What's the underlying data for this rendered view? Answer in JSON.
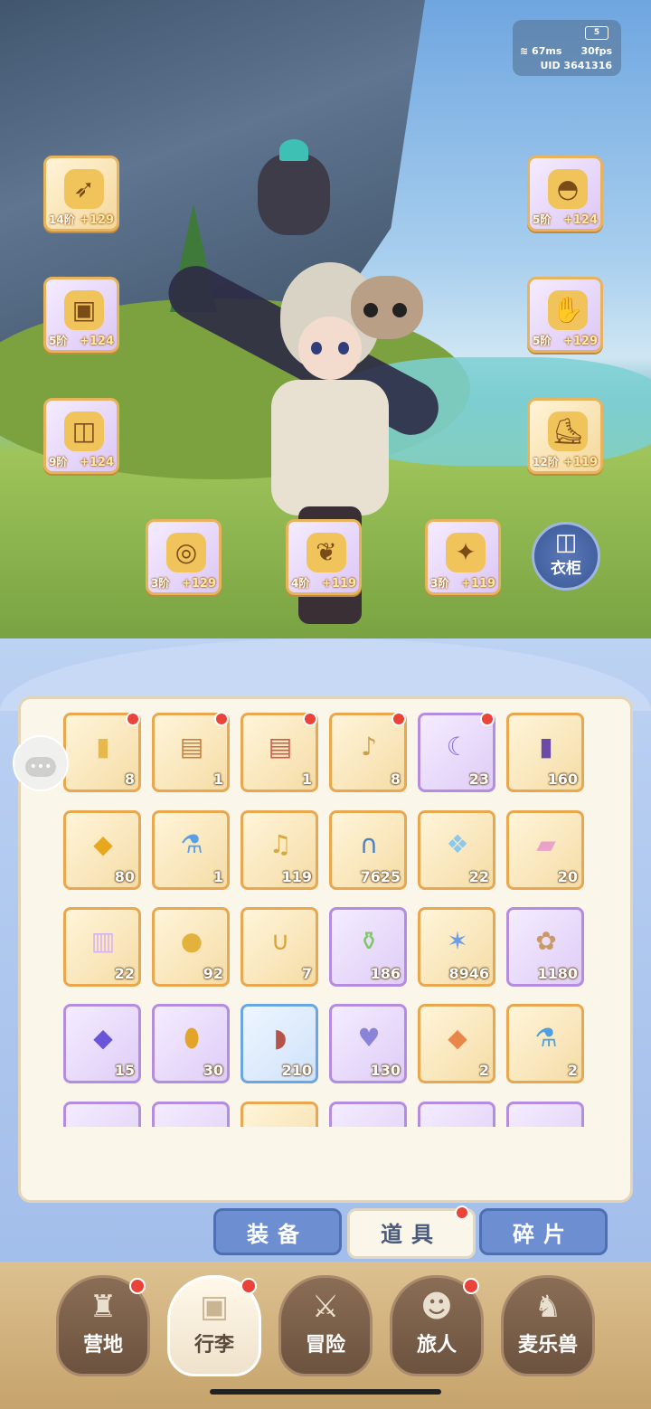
{
  "status": {
    "battery": "5",
    "ping": "67ms",
    "fps": "30fps",
    "uid": "UID 3641316"
  },
  "equipment": [
    {
      "slot": "bow",
      "tier": "14阶",
      "plus": "+129",
      "icon": "bow-icon",
      "glyph": "➶"
    },
    {
      "slot": "armor",
      "tier": "5阶",
      "plus": "+124",
      "icon": "armor-icon",
      "glyph": "▣"
    },
    {
      "slot": "pants",
      "tier": "9阶",
      "plus": "+124",
      "icon": "pants-icon",
      "glyph": "◫"
    },
    {
      "slot": "helmet",
      "tier": "5阶",
      "plus": "+124",
      "icon": "helmet-icon",
      "glyph": "◓"
    },
    {
      "slot": "gloves",
      "tier": "5阶",
      "plus": "+129",
      "icon": "gloves-icon",
      "glyph": "✋"
    },
    {
      "slot": "boots",
      "tier": "12阶",
      "plus": "+119",
      "icon": "boots-icon",
      "glyph": "⛸"
    },
    {
      "slot": "ring",
      "tier": "3阶",
      "plus": "+129",
      "icon": "ring-icon",
      "glyph": "◎"
    },
    {
      "slot": "necklace",
      "tier": "4阶",
      "plus": "+119",
      "icon": "necklace-icon",
      "glyph": "❦"
    },
    {
      "slot": "charm",
      "tier": "3阶",
      "plus": "+119",
      "icon": "charm-icon",
      "glyph": "✦"
    }
  ],
  "wardrobe": {
    "label": "衣柜",
    "icon": "wardrobe-icon"
  },
  "inventory": [
    {
      "count": "8",
      "icon": "card-icon",
      "glyph": "▮",
      "color": "#e9b84a",
      "rarity": "gold",
      "badge": true
    },
    {
      "count": "1",
      "icon": "chest-icon",
      "glyph": "▤",
      "color": "#c9803d",
      "rarity": "gold",
      "badge": true
    },
    {
      "count": "1",
      "icon": "red-chest-icon",
      "glyph": "▤",
      "color": "#d2584a",
      "rarity": "gold",
      "badge": true
    },
    {
      "count": "8",
      "icon": "bell-bag-icon",
      "glyph": "♪",
      "color": "#caa04a",
      "rarity": "gold",
      "badge": true
    },
    {
      "count": "23",
      "icon": "moon-ticket-icon",
      "glyph": "☾",
      "color": "#8c72d8",
      "rarity": "purple",
      "badge": true
    },
    {
      "count": "160",
      "icon": "purple-ticket-icon",
      "glyph": "▮",
      "color": "#6b4aa8",
      "rarity": "gold",
      "badge": false
    },
    {
      "count": "80",
      "icon": "amber-crystal-icon",
      "glyph": "◆",
      "color": "#e7a81e",
      "rarity": "gold",
      "badge": false
    },
    {
      "count": "1",
      "icon": "blue-potion-icon",
      "glyph": "⚗",
      "color": "#5b9ee8",
      "rarity": "gold",
      "badge": false
    },
    {
      "count": "119",
      "icon": "lyre-icon",
      "glyph": "♫",
      "color": "#d6a845",
      "rarity": "gold",
      "badge": false
    },
    {
      "count": "7625",
      "icon": "gate-orb-icon",
      "glyph": "∩",
      "color": "#4a7fc2",
      "rarity": "gold",
      "badge": false
    },
    {
      "count": "22",
      "icon": "ice-crystal-icon",
      "glyph": "❖",
      "color": "#8cc8ec",
      "rarity": "gold",
      "badge": false
    },
    {
      "count": "20",
      "icon": "rainbow-tube-icon",
      "glyph": "▰",
      "color": "#e9a2c8",
      "rarity": "gold",
      "badge": false
    },
    {
      "count": "22",
      "icon": "rainbow-bottle-icon",
      "glyph": "▥",
      "color": "#d9b1f0",
      "rarity": "gold",
      "badge": false
    },
    {
      "count": "92",
      "icon": "jingle-bell-icon",
      "glyph": "●",
      "color": "#e2b23c",
      "rarity": "gold",
      "badge": false
    },
    {
      "count": "7",
      "icon": "horseshoe-icon",
      "glyph": "∪",
      "color": "#d8a33a",
      "rarity": "gold",
      "badge": false
    },
    {
      "count": "186",
      "icon": "green-jar-icon",
      "glyph": "⚱",
      "color": "#7fc66b",
      "rarity": "purple",
      "badge": false
    },
    {
      "count": "8946",
      "icon": "blue-star-icon",
      "glyph": "✶",
      "color": "#6d9ce8",
      "rarity": "gold",
      "badge": false
    },
    {
      "count": "1180",
      "icon": "cookie-icon",
      "glyph": "✿",
      "color": "#c99a64",
      "rarity": "purple",
      "badge": false
    },
    {
      "count": "15",
      "icon": "purple-crystal-icon",
      "glyph": "◆",
      "color": "#6a55d8",
      "rarity": "purple",
      "badge": false
    },
    {
      "count": "30",
      "icon": "golden-egg-icon",
      "glyph": "⬮",
      "color": "#e2a52a",
      "rarity": "purple",
      "badge": false
    },
    {
      "count": "210",
      "icon": "meat-icon",
      "glyph": "◗",
      "color": "#b5524a",
      "rarity": "blue",
      "badge": false
    },
    {
      "count": "130",
      "icon": "heart-coin-icon",
      "glyph": "♥",
      "color": "#8a84d8",
      "rarity": "purple",
      "badge": false
    },
    {
      "count": "2",
      "icon": "orange-crystal-icon",
      "glyph": "◆",
      "color": "#e9874a",
      "rarity": "gold",
      "badge": false
    },
    {
      "count": "2",
      "icon": "blue-flask-icon",
      "glyph": "⚗",
      "color": "#4fa0e0",
      "rarity": "gold",
      "badge": false
    },
    {
      "count": "",
      "icon": "bottle-icon",
      "glyph": "",
      "color": "#d8cdee",
      "rarity": "purple",
      "badge": false
    },
    {
      "count": "",
      "icon": "key-icon",
      "glyph": "",
      "color": "#e8c070",
      "rarity": "purple",
      "badge": false
    },
    {
      "count": "",
      "icon": "scroll-icon",
      "glyph": "",
      "color": "#e9c060",
      "rarity": "gold",
      "badge": false
    },
    {
      "count": "",
      "icon": "cat-icon",
      "glyph": "",
      "color": "#e9c070",
      "rarity": "purple",
      "badge": false
    },
    {
      "count": "",
      "icon": "bread-icon",
      "glyph": "",
      "color": "#e8c080",
      "rarity": "purple",
      "badge": false
    },
    {
      "count": "",
      "icon": "gem-icon",
      "glyph": "",
      "color": "#f0d060",
      "rarity": "purple",
      "badge": false
    }
  ],
  "tabs": [
    {
      "label": "装备",
      "active": false,
      "badge": false
    },
    {
      "label": "道具",
      "active": true,
      "badge": true
    },
    {
      "label": "碎片",
      "active": false,
      "badge": false
    }
  ],
  "nav": [
    {
      "label": "营地",
      "icon": "castle-icon",
      "glyph": "♜",
      "active": false,
      "badge": true
    },
    {
      "label": "行李",
      "icon": "backpack-icon",
      "glyph": "▣",
      "active": true,
      "badge": true
    },
    {
      "label": "冒险",
      "icon": "crossed-swords-icon",
      "glyph": "⚔",
      "active": false,
      "badge": false
    },
    {
      "label": "旅人",
      "icon": "traveler-icon",
      "glyph": "☻",
      "active": false,
      "badge": true
    },
    {
      "label": "麦乐兽",
      "icon": "cat-beast-icon",
      "glyph": "♞",
      "active": false,
      "badge": false
    }
  ]
}
